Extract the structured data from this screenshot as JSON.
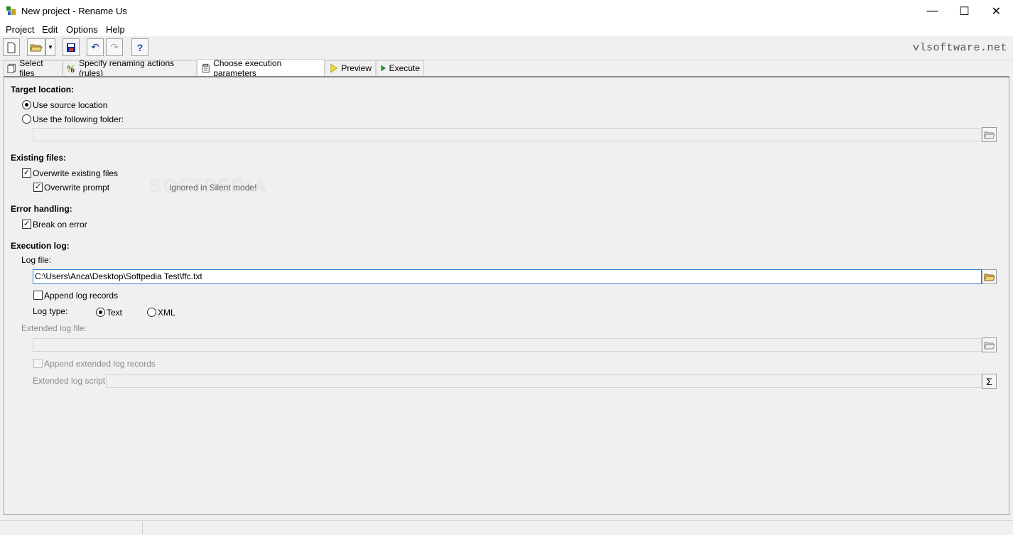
{
  "window": {
    "title": "New project - Rename Us",
    "minimize": "—",
    "maximize": "☐",
    "close": "✕"
  },
  "menu": [
    "Project",
    "Edit",
    "Options",
    "Help"
  ],
  "toolbar": {
    "brand": "vlsoftware.net"
  },
  "tabs": [
    {
      "label": "Select files"
    },
    {
      "label": "Specify renaming actions (rules)"
    },
    {
      "label": "Choose execution parameters"
    },
    {
      "label": "Preview"
    },
    {
      "label": "Execute"
    }
  ],
  "target": {
    "heading": "Target location:",
    "use_source": "Use source location",
    "use_folder": "Use the following folder:",
    "folder_value": ""
  },
  "existing": {
    "heading": "Existing files:",
    "overwrite": "Overwrite existing files",
    "overwrite_prompt": "Overwrite prompt",
    "note": "Ignored in Silent mode!"
  },
  "errors": {
    "heading": "Error handling:",
    "break_on_error": "Break on error"
  },
  "log": {
    "heading": "Execution log:",
    "log_file_label": "Log file:",
    "log_file_value": "C:\\Users\\Anca\\Desktop\\Softpedia Test\\ffc.txt",
    "append": "Append log records",
    "log_type_label": "Log type:",
    "type_text": "Text",
    "type_xml": "XML",
    "ext_log_label": "Extended log file:",
    "ext_append": "Append extended log records",
    "ext_script_label": "Extended log script:",
    "sigma": "Σ"
  },
  "watermark": "SOFTPEDIA",
  "colors": {
    "accent": "#2c7bd0"
  }
}
